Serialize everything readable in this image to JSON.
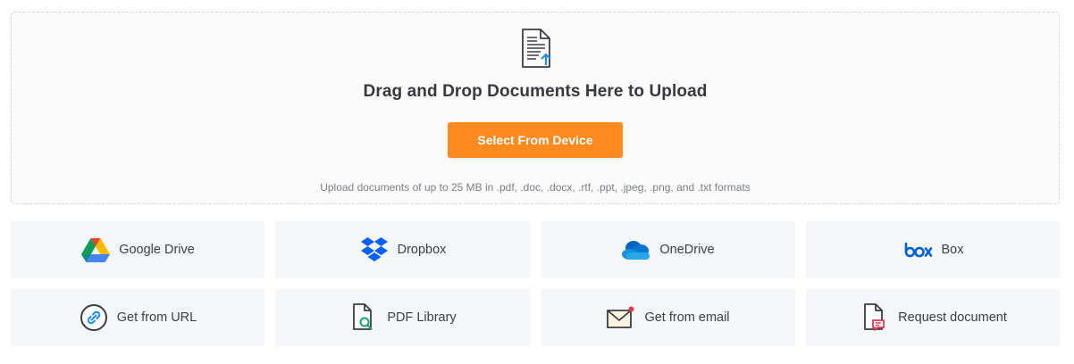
{
  "dropzone": {
    "title": "Drag and Drop Documents Here to Upload",
    "button_label": "Select From Device",
    "hint": "Upload documents of up to 25 MB in .pdf, .doc, .docx, .rtf, .ppt, .jpeg, .png, and .txt formats"
  },
  "sources": [
    {
      "label": "Google Drive",
      "icon": "google-drive-icon"
    },
    {
      "label": "Dropbox",
      "icon": "dropbox-icon"
    },
    {
      "label": "OneDrive",
      "icon": "onedrive-icon"
    },
    {
      "label": "Box",
      "icon": "box-icon"
    },
    {
      "label": "Get from URL",
      "icon": "link-icon"
    },
    {
      "label": "PDF Library",
      "icon": "pdf-library-icon"
    },
    {
      "label": "Get from email",
      "icon": "email-icon"
    },
    {
      "label": "Request document",
      "icon": "request-document-icon"
    }
  ],
  "colors": {
    "accent": "#ff8a1f",
    "upload_arrow": "#1a8cff",
    "tile_bg": "#f5f6f8"
  }
}
